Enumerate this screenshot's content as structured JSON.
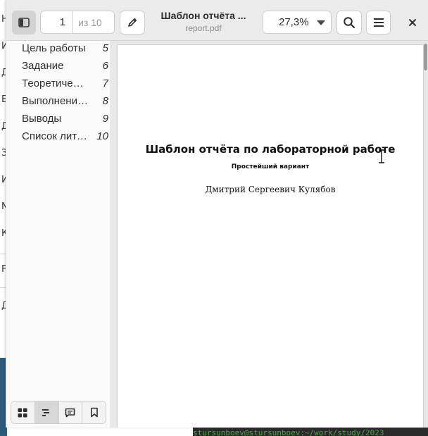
{
  "window": {
    "title": "Шаблон отчёта ...",
    "subtitle": "report.pdf"
  },
  "header": {
    "page_current": "1",
    "page_total": "из 10",
    "zoom": "27,3%"
  },
  "outline": [
    {
      "label": "Цель работы",
      "page": "5"
    },
    {
      "label": "Задание",
      "page": "6"
    },
    {
      "label": "Теоретичес…",
      "page": "7"
    },
    {
      "label": "Выполнение…",
      "page": "8"
    },
    {
      "label": "Выводы",
      "page": "9"
    },
    {
      "label": "Список лите…",
      "page": "10"
    }
  ],
  "sidebar_switcher": {
    "active": "outline",
    "buttons": [
      "thumbnails-icon",
      "outline-icon",
      "annotations-icon",
      "bookmarks-icon"
    ]
  },
  "document": {
    "heading": "Шаблон отчёта по лабораторной работе",
    "subheading": "Простейший вариант",
    "author": "Дмитрий Сергеевич Кулябов"
  },
  "background": {
    "left_letters": [
      "Н",
      "И",
      "Д",
      "Е",
      "Д",
      "З",
      "И",
      "N",
      "К",
      "F",
      "Д"
    ],
    "terminal_text": "stursunboev@stursunboev:~/work/study/2023"
  },
  "colors": {
    "header_bg": "#ebebeb",
    "sidebar_bg": "#fafafa",
    "doc_bg": "#e8e8e8",
    "active_toggle": "#d7d7d7"
  }
}
